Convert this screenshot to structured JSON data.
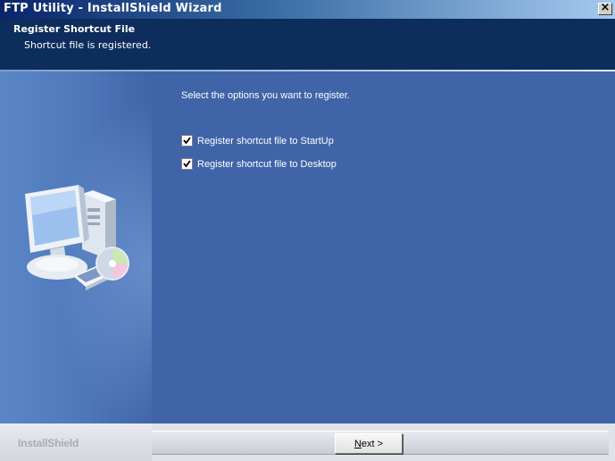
{
  "window": {
    "title": "FTP Utility - InstallShield Wizard",
    "close_glyph": "×"
  },
  "header": {
    "title": "Register Shortcut File",
    "subtitle": "Shortcut file is registered."
  },
  "content": {
    "prompt": "Select the options you want to register.",
    "options": [
      {
        "label": "Register shortcut file to StartUp",
        "checked": true
      },
      {
        "label": "Register shortcut file to Desktop",
        "checked": true
      }
    ]
  },
  "footer": {
    "brand": "InstallShield",
    "next_button": {
      "mnemonic": "N",
      "rest": "ext >"
    }
  },
  "colors": {
    "header_bg": "#0d2d5c",
    "body_bg": "#3f64a8",
    "footer_bg": "#dfe2e8"
  },
  "icons": {
    "close": "close-icon",
    "illustration": "computer-with-cd-icon",
    "checkmark": "checkmark-icon"
  }
}
